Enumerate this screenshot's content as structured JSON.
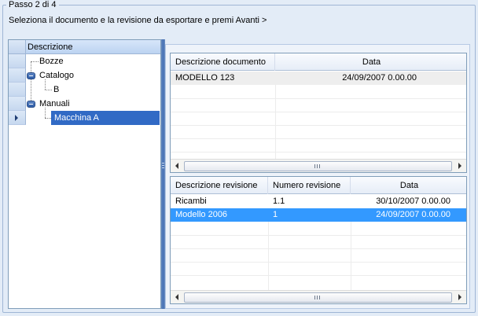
{
  "step": {
    "title": "Passo 2 di 4"
  },
  "instruction": "Seleziona il documento e la revisione da esportare e premi Avanti >",
  "tree": {
    "header": "Descrizione",
    "nodes": [
      {
        "label": "Bozze"
      },
      {
        "label": "Catalogo"
      },
      {
        "label": "B"
      },
      {
        "label": "Manuali"
      },
      {
        "label": "Macchina A",
        "selected": true
      }
    ]
  },
  "documents": {
    "columns": [
      "Descrizione documento",
      "Data"
    ],
    "rows": [
      {
        "descrizione": "MODELLO 123",
        "data": "24/09/2007 0.00.00"
      }
    ],
    "scroll_grip": "|||"
  },
  "revisions": {
    "columns": [
      "Descrizione revisione",
      "Numero revisione",
      "Data"
    ],
    "rows": [
      {
        "descrizione": "Ricambi",
        "numero": "1.1",
        "data": "30/10/2007 0.00.00"
      },
      {
        "descrizione": "Modello 2006",
        "numero": "1",
        "data": "24/09/2007 0.00.00",
        "selected": true
      }
    ],
    "scroll_grip": "|||"
  },
  "colors": {
    "selection": "#3399ff",
    "tree_selection": "#316ac5",
    "splitter": "#4470b4",
    "background": "#e3ecf7"
  }
}
